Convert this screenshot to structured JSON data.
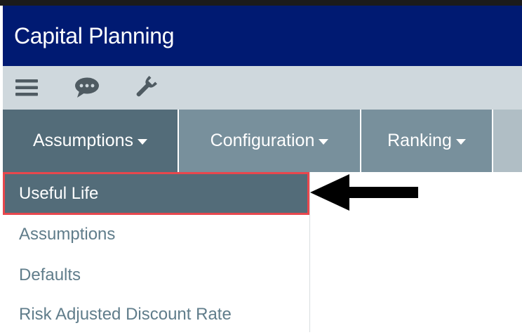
{
  "app": {
    "title": "Capital Planning"
  },
  "toolbar": {
    "icons": [
      "menu-icon",
      "chat-icon",
      "wrench-icon"
    ]
  },
  "nav": {
    "tabs": [
      {
        "label": "Assumptions",
        "active": true
      },
      {
        "label": "Configuration",
        "active": false
      },
      {
        "label": "Ranking",
        "active": false
      }
    ]
  },
  "dropdown": {
    "items": [
      {
        "label": "Useful Life",
        "selected": true
      },
      {
        "label": "Assumptions",
        "selected": false
      },
      {
        "label": "Defaults",
        "selected": false
      },
      {
        "label": "Risk Adjusted Discount Rate",
        "selected": false
      }
    ]
  },
  "colors": {
    "header_bg": "#001a72",
    "toolbar_bg": "#cfd8dd",
    "tab_active_bg": "#536c79",
    "tab_bg": "#78909c",
    "menu_text": "#607d8b",
    "highlight_border": "#e8474d",
    "annotation_arrow": "#000000"
  }
}
